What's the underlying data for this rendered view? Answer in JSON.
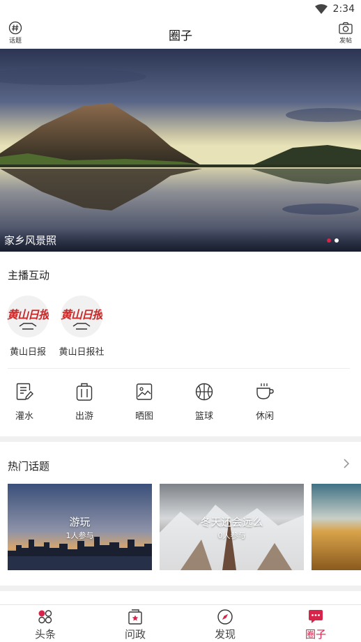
{
  "status_bar": {
    "time": "2:34"
  },
  "header": {
    "title": "圈子",
    "left_button": {
      "label": "话题",
      "icon": "hashtag-icon"
    },
    "right_button": {
      "label": "发帖",
      "icon": "camera-icon"
    }
  },
  "banner": {
    "caption": "家乡风景照",
    "slide_count": 2,
    "active_slide": 1,
    "active_dot_color": "#d6244a"
  },
  "anchors_section": {
    "title": "主播互动",
    "items": [
      {
        "name": "黄山日报",
        "logo_text": "黄山日报"
      },
      {
        "name": "黄山日报社",
        "logo_text": "黄山日报"
      }
    ]
  },
  "categories": [
    {
      "label": "灌水",
      "icon": "notepad-pen-icon"
    },
    {
      "label": "出游",
      "icon": "luggage-icon"
    },
    {
      "label": "晒图",
      "icon": "photo-icon"
    },
    {
      "label": "篮球",
      "icon": "basketball-icon"
    },
    {
      "label": "休闲",
      "icon": "coffee-cup-icon"
    }
  ],
  "hot_topics": {
    "title": "热门话题",
    "items": [
      {
        "title": "游玩",
        "count": "1人参与"
      },
      {
        "title": "冬天还会远么",
        "count": "0人参与"
      },
      {
        "title": "",
        "count": ""
      }
    ]
  },
  "tabbar": {
    "accent_color": "#d6244a",
    "items": [
      {
        "label": "头条",
        "icon": "headlines-icon",
        "active": false
      },
      {
        "label": "问政",
        "icon": "inquiry-icon",
        "active": false
      },
      {
        "label": "发现",
        "icon": "compass-icon",
        "active": false
      },
      {
        "label": "圈子",
        "icon": "chat-bubble-icon",
        "active": true
      }
    ]
  }
}
